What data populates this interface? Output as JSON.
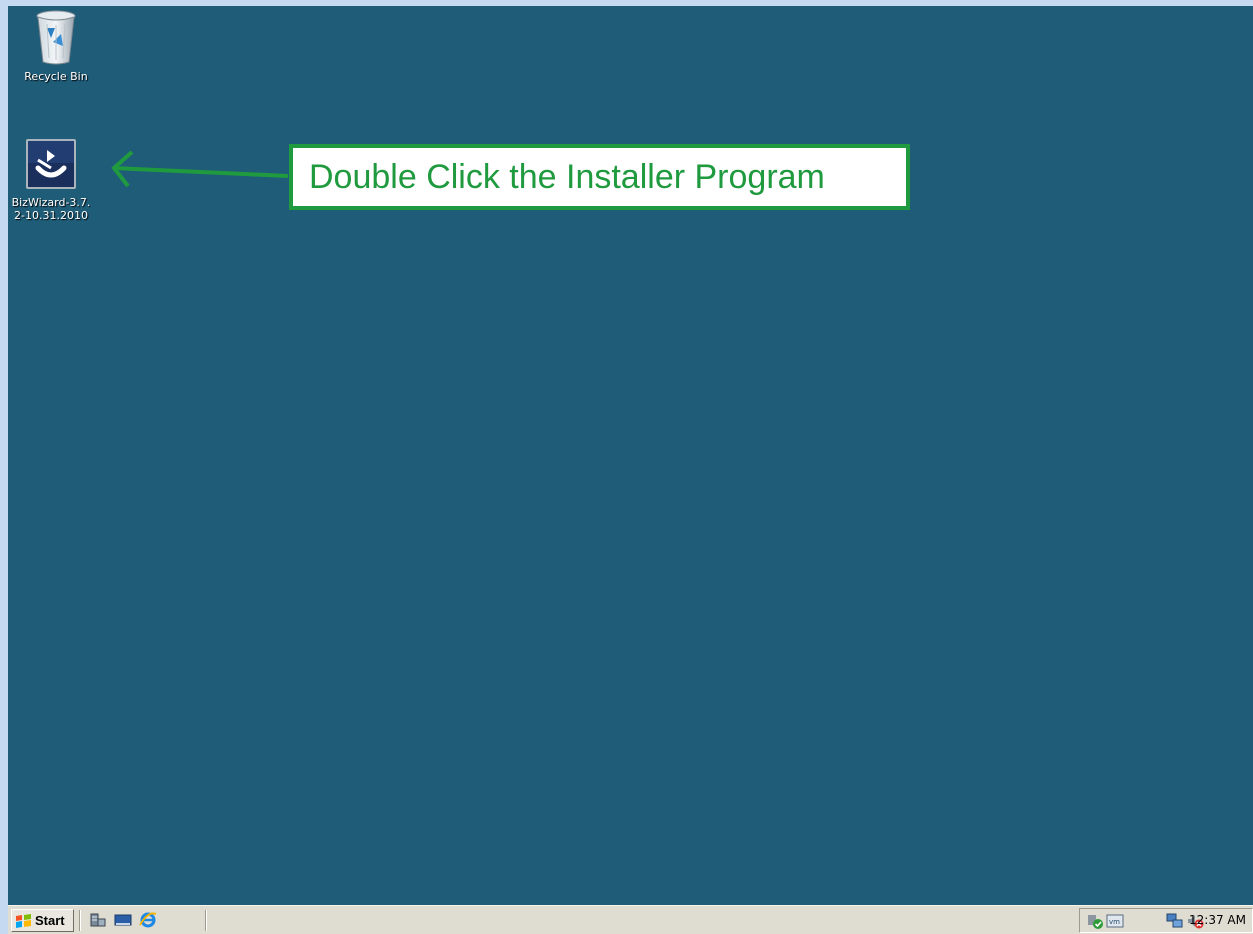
{
  "desktop": {
    "icons": [
      {
        "label": "Recycle Bin",
        "icon": "recycle-bin-icon"
      },
      {
        "label": "BizWizard-3.7.2-10.31.2010",
        "icon": "installer-icon"
      }
    ],
    "background_color": "#1f5c78"
  },
  "annotation": {
    "text": "Double Click the Installer Program",
    "color": "#1f9a3e"
  },
  "taskbar": {
    "start_label": "Start",
    "quick_launch": [
      "server-manager-icon",
      "show-desktop-icon",
      "internet-explorer-icon"
    ],
    "tray_icons": [
      "update-shield-icon",
      "vmware-tools-icon",
      "network-icon",
      "volume-muted-icon"
    ],
    "clock": "12:37 AM"
  }
}
